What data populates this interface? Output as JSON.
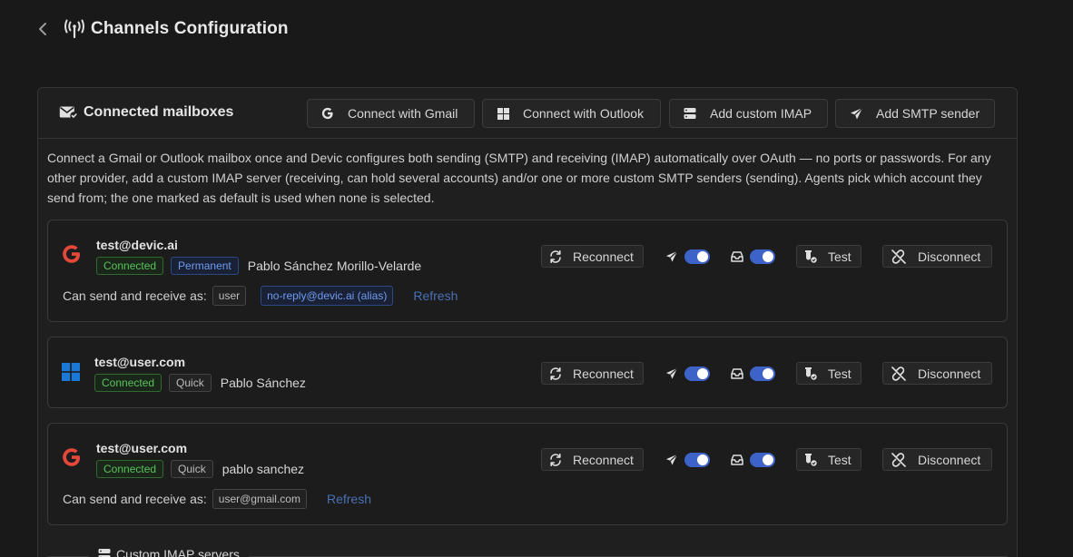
{
  "page": {
    "title": "Channels Configuration"
  },
  "panel": {
    "title": "Connected mailboxes",
    "buttons": {
      "gmail": "Connect with Gmail",
      "outlook": "Connect with Outlook",
      "imap": "Add custom IMAP",
      "smtp": "Add SMTP sender"
    },
    "description": "Connect a Gmail or Outlook mailbox once and Devic configures both sending (SMTP) and receiving (IMAP) automatically over OAuth — no ports or passwords. For any other provider, add a custom IMAP server (receiving, can hold several accounts) and/or one or more custom SMTP senders (sending). Agents pick which account they send from; the one marked as default is used when none is selected."
  },
  "actions": {
    "reconnect": "Reconnect",
    "test": "Test",
    "disconnect": "Disconnect"
  },
  "send_as_label": "Can send and receive as:",
  "refresh_label": "Refresh",
  "mailboxes": [
    {
      "provider": "google",
      "email": "test@devic.ai",
      "status": "Connected",
      "type": "Permanent",
      "owner": "Pablo Sánchez Morillo-Velarde",
      "aliases": [
        "user",
        "no-reply@devic.ai (alias)"
      ],
      "send_enabled": true,
      "receive_enabled": true
    },
    {
      "provider": "microsoft",
      "email": "test@user.com",
      "status": "Connected",
      "type": "Quick",
      "owner": "Pablo Sánchez",
      "send_enabled": true,
      "receive_enabled": true
    },
    {
      "provider": "google",
      "email": "test@user.com",
      "status": "Connected",
      "type": "Quick",
      "owner": "pablo sanchez",
      "aliases": [
        "user@gmail.com"
      ],
      "send_enabled": true,
      "receive_enabled": true
    }
  ],
  "bottom_section": {
    "title": "Custom IMAP servers"
  },
  "colors": {
    "background": "#191919",
    "accent_toggle": "#3d63c9",
    "connected": "#59c25a",
    "permanent": "#6e9cf2",
    "link": "#4a6fb5"
  }
}
